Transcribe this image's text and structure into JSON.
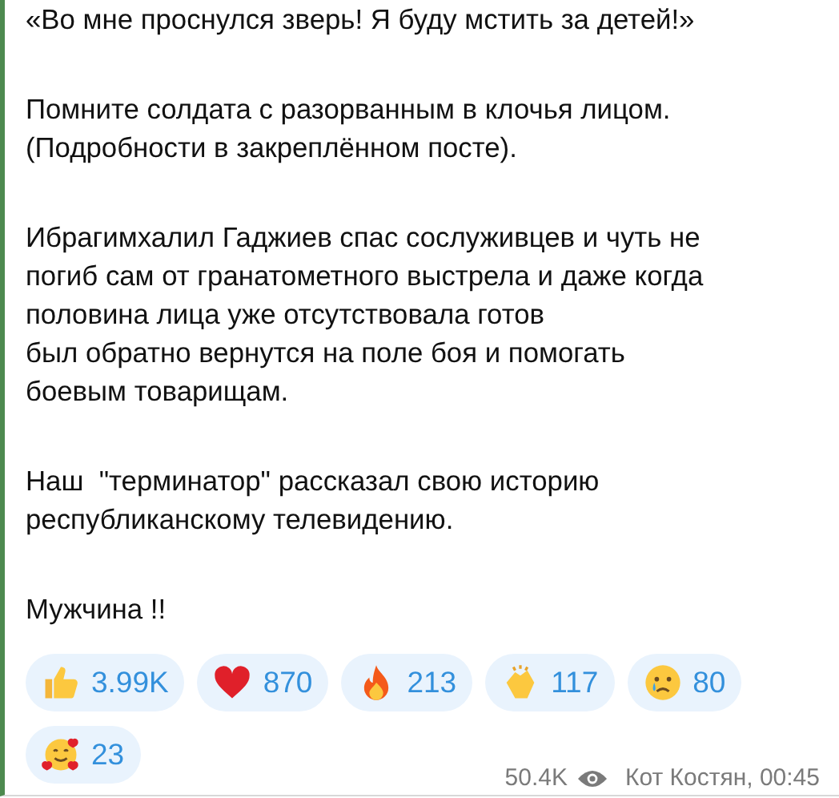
{
  "message": {
    "paragraphs": [
      [
        "«Во мне проснулся зверь! Я буду мстить за детей!»"
      ],
      [
        "Помните солдата с разорванным в клочья лицом.",
        "(Подробности в закреплённом посте)."
      ],
      [
        "Ибрагимхалил Гаджиев спас сослуживцев и чуть не",
        "погиб сам от гранатометного выстрела и даже когда",
        "половина лица уже отсутствовала готов",
        "был обратно вернутся на поле боя и помогать",
        "боевым товарищам."
      ],
      [
        "Наш  \"терминатор\" рассказал свою историю",
        "республиканскому телевидению."
      ],
      [
        "Мужчина !!"
      ]
    ],
    "reactions": [
      {
        "kind": "thumbs-up",
        "count": "3.99K"
      },
      {
        "kind": "heart",
        "count": "870"
      },
      {
        "kind": "fire",
        "count": "213"
      },
      {
        "kind": "clap",
        "count": "117"
      },
      {
        "kind": "cry",
        "count": "80"
      },
      {
        "kind": "hearts-face",
        "count": "23"
      }
    ],
    "views": "50.4K",
    "author_time": "Кот Костян, 00:45"
  }
}
